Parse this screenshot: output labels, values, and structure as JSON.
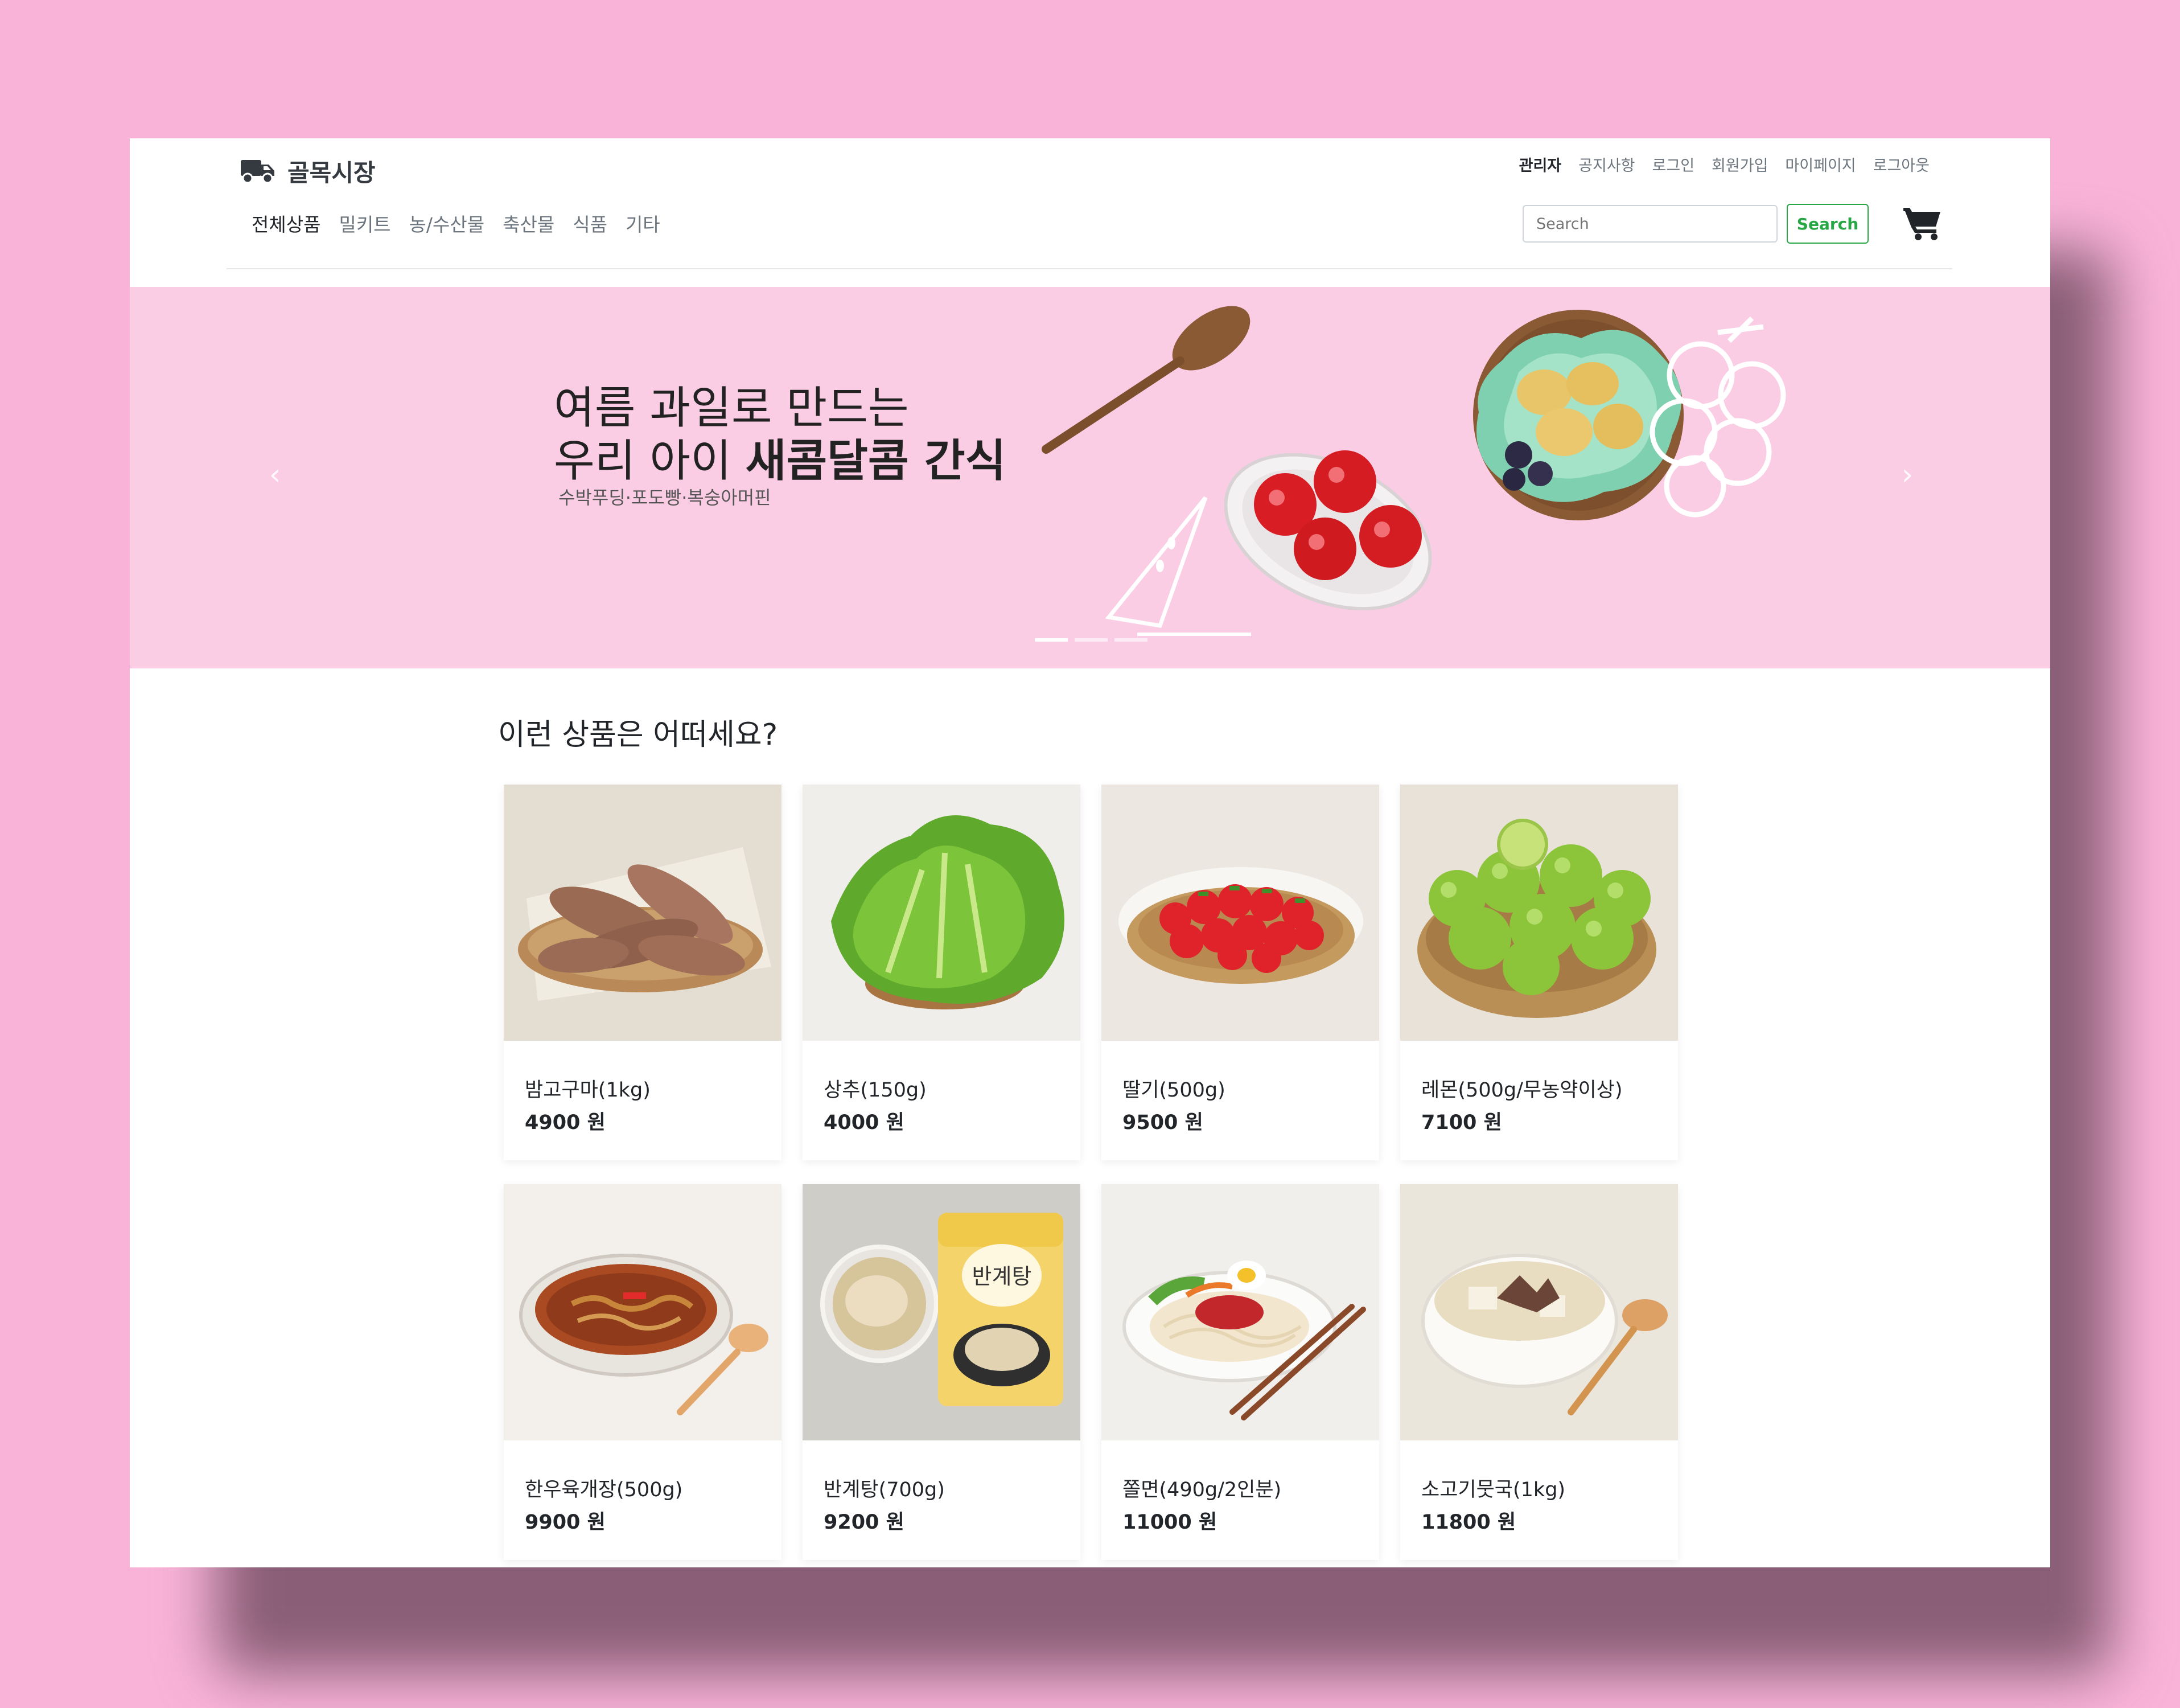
{
  "header": {
    "brand": "골목시장",
    "top_links": [
      "관리자",
      "공지사항",
      "로그인",
      "회원가입",
      "마이페이지",
      "로그아웃"
    ],
    "categories": [
      "전체상품",
      "밀키트",
      "농/수산물",
      "축산물",
      "식품",
      "기타"
    ],
    "search": {
      "placeholder": "Search",
      "button_label": "Search"
    }
  },
  "banner": {
    "line1": "여름 과일로 만드는",
    "line2_regular": "우리 아이 ",
    "line2_bold": "새콤달콤 간식",
    "subtitle": "수박푸딩·포도빵·복숭아머핀",
    "prev_icon": "‹",
    "next_icon": "›"
  },
  "section_title": "이런 상품은 어떠세요?",
  "products": [
    {
      "name": "밤고구마(1kg)",
      "price": "4900 원",
      "image": "sweet-potato"
    },
    {
      "name": "상추(150g)",
      "price": "4000 원",
      "image": "lettuce"
    },
    {
      "name": "딸기(500g)",
      "price": "9500 원",
      "image": "strawberry"
    },
    {
      "name": "레몬(500g/무농약이상)",
      "price": "7100 원",
      "image": "lime"
    },
    {
      "name": "한우육개장(500g)",
      "price": "9900 원",
      "image": "yukgaejang"
    },
    {
      "name": "반계탕(700g)",
      "price": "9200 원",
      "image": "bangyetang"
    },
    {
      "name": "쫄면(490g/2인분)",
      "price": "11000 원",
      "image": "jjolmyeon"
    },
    {
      "name": "소고기뭇국(1kg)",
      "price": "11800 원",
      "image": "radish-soup"
    }
  ],
  "product_package_text": "반계탕",
  "colors": {
    "page_bg": "#f9b3d9",
    "banner_bg": "#fbcde5",
    "success": "#28a745"
  }
}
